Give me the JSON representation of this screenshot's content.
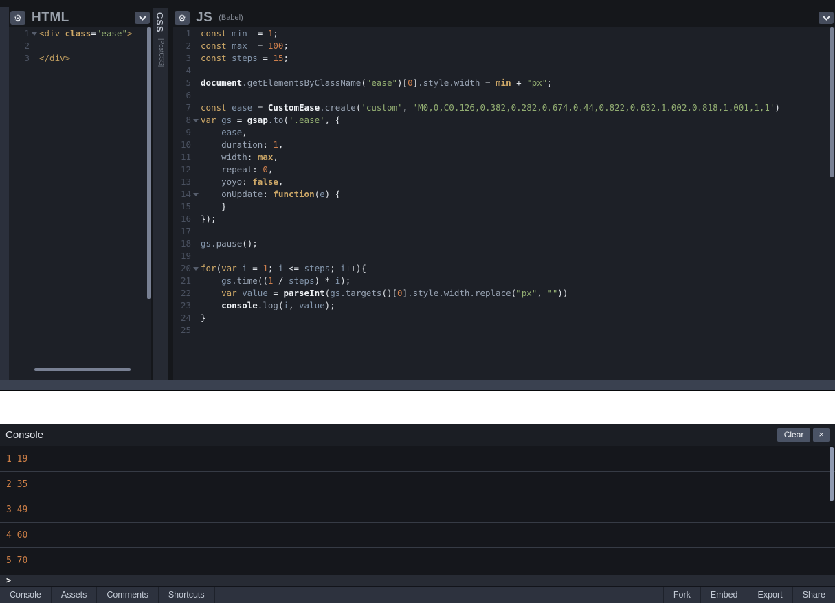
{
  "editors": {
    "html": {
      "title": "HTML",
      "folds": [
        1
      ],
      "lines": [
        [
          [
            "t",
            "<div "
          ],
          [
            "kb",
            "class"
          ],
          [
            "o",
            "="
          ],
          [
            "s",
            "\"ease\""
          ],
          [
            "t",
            ">"
          ]
        ],
        [],
        [
          [
            "t",
            "</div>"
          ]
        ]
      ]
    },
    "css": {
      "title": "CSS",
      "subtitle": "|PostCSS|"
    },
    "js": {
      "title": "JS",
      "subtitle": "(Babel)",
      "folds": [
        8,
        14,
        20
      ],
      "lines": [
        [
          [
            "k",
            "const"
          ],
          [
            "o",
            " "
          ],
          [
            "v",
            "min"
          ],
          [
            "o",
            "  = "
          ],
          [
            "n",
            "1"
          ],
          [
            "o",
            ";"
          ]
        ],
        [
          [
            "k",
            "const"
          ],
          [
            "o",
            " "
          ],
          [
            "v",
            "max"
          ],
          [
            "o",
            "  = "
          ],
          [
            "n",
            "100"
          ],
          [
            "o",
            ";"
          ]
        ],
        [
          [
            "k",
            "const"
          ],
          [
            "o",
            " "
          ],
          [
            "v",
            "steps"
          ],
          [
            "o",
            " = "
          ],
          [
            "n",
            "15"
          ],
          [
            "o",
            ";"
          ]
        ],
        [],
        [
          [
            "b",
            "document"
          ],
          [
            "p",
            ".getElementsByClassName"
          ],
          [
            "o",
            "("
          ],
          [
            "s",
            "\"ease\""
          ],
          [
            "o",
            ")["
          ],
          [
            "n",
            "0"
          ],
          [
            "o",
            "]"
          ],
          [
            "p",
            ".style"
          ],
          [
            "p",
            ".width"
          ],
          [
            "o",
            " = "
          ],
          [
            "kb",
            "min"
          ],
          [
            "o",
            " + "
          ],
          [
            "s",
            "\"px\""
          ],
          [
            "o",
            ";"
          ]
        ],
        [],
        [
          [
            "k",
            "const"
          ],
          [
            "o",
            " "
          ],
          [
            "v",
            "ease"
          ],
          [
            "o",
            " = "
          ],
          [
            "b",
            "CustomEase"
          ],
          [
            "p",
            ".create"
          ],
          [
            "o",
            "("
          ],
          [
            "s",
            "'custom'"
          ],
          [
            "o",
            ", "
          ],
          [
            "s",
            "'M0,0,C0.126,0.382,0.282,0.674,0.44,0.822,0.632,1.002,0.818,1.001,1,1'"
          ],
          [
            "o",
            ")"
          ]
        ],
        [
          [
            "k",
            "var"
          ],
          [
            "o",
            " "
          ],
          [
            "v",
            "gs"
          ],
          [
            "o",
            " = "
          ],
          [
            "b",
            "gsap"
          ],
          [
            "p",
            ".to"
          ],
          [
            "o",
            "("
          ],
          [
            "s",
            "'.ease'"
          ],
          [
            "o",
            ", {"
          ]
        ],
        [
          [
            "o",
            "    "
          ],
          [
            "v",
            "ease"
          ],
          [
            "o",
            ","
          ]
        ],
        [
          [
            "o",
            "    "
          ],
          [
            "p",
            "duration"
          ],
          [
            "o",
            ": "
          ],
          [
            "n",
            "1"
          ],
          [
            "o",
            ","
          ]
        ],
        [
          [
            "o",
            "    "
          ],
          [
            "p",
            "width"
          ],
          [
            "o",
            ": "
          ],
          [
            "kb",
            "max"
          ],
          [
            "o",
            ","
          ]
        ],
        [
          [
            "o",
            "    "
          ],
          [
            "p",
            "repeat"
          ],
          [
            "o",
            ": "
          ],
          [
            "n",
            "0"
          ],
          [
            "o",
            ","
          ]
        ],
        [
          [
            "o",
            "    "
          ],
          [
            "p",
            "yoyo"
          ],
          [
            "o",
            ": "
          ],
          [
            "kb",
            "false"
          ],
          [
            "o",
            ","
          ]
        ],
        [
          [
            "o",
            "    "
          ],
          [
            "p",
            "onUpdate"
          ],
          [
            "o",
            ": "
          ],
          [
            "kb",
            "function"
          ],
          [
            "o",
            "("
          ],
          [
            "v",
            "e"
          ],
          [
            "o",
            ") {"
          ]
        ],
        [
          [
            "o",
            "    }"
          ]
        ],
        [
          [
            "o",
            "});"
          ]
        ],
        [],
        [
          [
            "v",
            "gs"
          ],
          [
            "p",
            ".pause"
          ],
          [
            "o",
            "();"
          ]
        ],
        [],
        [
          [
            "k",
            "for"
          ],
          [
            "o",
            "("
          ],
          [
            "k",
            "var"
          ],
          [
            "o",
            " "
          ],
          [
            "v",
            "i"
          ],
          [
            "o",
            " = "
          ],
          [
            "n",
            "1"
          ],
          [
            "o",
            "; "
          ],
          [
            "v",
            "i"
          ],
          [
            "o",
            " <= "
          ],
          [
            "v",
            "steps"
          ],
          [
            "o",
            "; "
          ],
          [
            "v",
            "i"
          ],
          [
            "o",
            "++){"
          ]
        ],
        [
          [
            "o",
            "    "
          ],
          [
            "v",
            "gs"
          ],
          [
            "p",
            ".time"
          ],
          [
            "o",
            "(("
          ],
          [
            "n",
            "1"
          ],
          [
            "o",
            " / "
          ],
          [
            "v",
            "steps"
          ],
          [
            "o",
            ") * "
          ],
          [
            "v",
            "i"
          ],
          [
            "o",
            ");"
          ]
        ],
        [
          [
            "o",
            "    "
          ],
          [
            "k",
            "var"
          ],
          [
            "o",
            " "
          ],
          [
            "v",
            "value"
          ],
          [
            "o",
            " = "
          ],
          [
            "b",
            "parseInt"
          ],
          [
            "o",
            "("
          ],
          [
            "v",
            "gs"
          ],
          [
            "p",
            ".targets"
          ],
          [
            "o",
            "()["
          ],
          [
            "n",
            "0"
          ],
          [
            "o",
            "]"
          ],
          [
            "p",
            ".style"
          ],
          [
            "p",
            ".width"
          ],
          [
            "p",
            ".replace"
          ],
          [
            "o",
            "("
          ],
          [
            "s",
            "\"px\""
          ],
          [
            "o",
            ", "
          ],
          [
            "s",
            "\"\""
          ],
          [
            "o",
            "))"
          ]
        ],
        [
          [
            "o",
            "    "
          ],
          [
            "b",
            "console"
          ],
          [
            "p",
            ".log"
          ],
          [
            "o",
            "("
          ],
          [
            "v",
            "i"
          ],
          [
            "o",
            ", "
          ],
          [
            "v",
            "value"
          ],
          [
            "o",
            ");"
          ]
        ],
        [
          [
            "o",
            "}"
          ]
        ],
        []
      ]
    }
  },
  "icons": {
    "gear": "⚙",
    "close": "×"
  },
  "console": {
    "title": "Console",
    "clear_label": "Clear",
    "prompt": ">",
    "entries": [
      "1 19",
      "2 35",
      "3 49",
      "4 60",
      "5 70"
    ]
  },
  "footer": {
    "left_tabs": [
      "Console",
      "Assets",
      "Comments",
      "Shortcuts"
    ],
    "right_tabs": [
      "Fork",
      "Embed",
      "Export",
      "Share"
    ]
  },
  "colors": {
    "accent_log": "#cd7f47",
    "editor_bg": "#1d2027",
    "keyword": "#cfa968",
    "string": "#93ae72",
    "number": "#cd7f4d"
  }
}
